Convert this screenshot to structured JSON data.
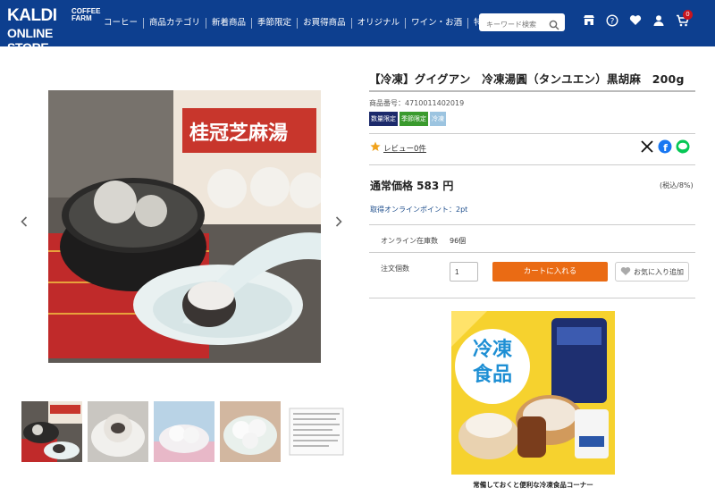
{
  "header": {
    "logo": {
      "brand": "KALDI",
      "coffee": "COFFEE",
      "farm": "FARM",
      "online": "ONLINE STORE"
    },
    "nav": [
      "コーヒー",
      "商品カテゴリ",
      "新着商品",
      "季節限定",
      "お買得商品",
      "オリジナル",
      "ワイン・お酒",
      "特集"
    ],
    "search_placeholder": "キーワード検索",
    "icons": [
      "store-icon",
      "help-icon",
      "heart-icon",
      "user-icon",
      "cart-icon"
    ],
    "cart_count": "0"
  },
  "product": {
    "title": "【冷凍】グイグアン　冷凍湯圓（タンユエン）黒胡麻　200g",
    "number": "商品番号：4710011402019",
    "tags": [
      {
        "label": "数量限定",
        "color": "#1c2a6b"
      },
      {
        "label": "季節限定",
        "color": "#3a9a2d"
      },
      {
        "label": "冷凍",
        "color": "#9cc4e0"
      }
    ],
    "review_link": "レビュー0件",
    "price": "通常価格 583 円",
    "tax": "(税込/8%)",
    "points": "取得オンラインポイント：2pt",
    "stock_label": "オンライン在庫数",
    "stock_value": "96個",
    "qty_label": "注文個数",
    "qty_value": "1",
    "cart_button": "カートに入れる",
    "fav_button": "お気に入り追加"
  },
  "image": {
    "package_text": "桂冠芝麻湯"
  },
  "banner": {
    "line1": "冷凍",
    "line2": "食品",
    "caption": "常備しておくと便利な冷凍食品コーナー"
  },
  "colors": {
    "header": "#0d3f8f",
    "cart": "#ea6b14",
    "banner": "#f6d22e"
  }
}
